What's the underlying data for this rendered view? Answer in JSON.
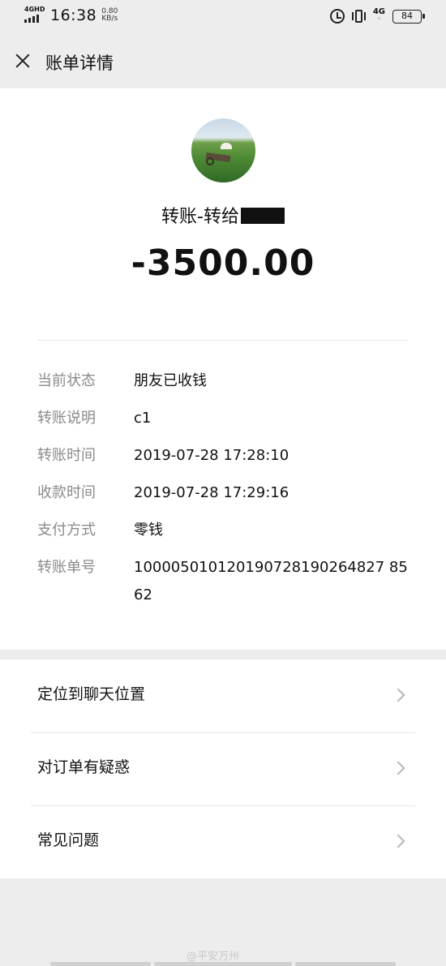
{
  "status_bar": {
    "network_label": "4GHD",
    "time": "16:38",
    "speed_value": "0.80",
    "speed_unit": "KB/s",
    "net_type": "4G",
    "battery": "84",
    "icons": [
      "signal-icon",
      "alarm-icon",
      "vibrate-icon",
      "battery-icon"
    ]
  },
  "header": {
    "title": "账单详情",
    "close_icon": "close-icon"
  },
  "transfer": {
    "payee_text": "转账-转给",
    "amount": "-3500.00"
  },
  "details": [
    {
      "label": "当前状态",
      "value": "朋友已收钱"
    },
    {
      "label": "转账说明",
      "value": "c1"
    },
    {
      "label": "转账时间",
      "value": "2019-07-28 17:28:10"
    },
    {
      "label": "收款时间",
      "value": "2019-07-28 17:29:16"
    },
    {
      "label": "支付方式",
      "value": "零钱"
    },
    {
      "label": "转账单号",
      "value": "100005010120190728190264827 8562"
    }
  ],
  "menu": [
    {
      "label": "定位到聊天位置",
      "icon": "chevron-right-icon"
    },
    {
      "label": "对订单有疑惑",
      "icon": "chevron-right-icon"
    },
    {
      "label": "常见问题",
      "icon": "chevron-right-icon"
    }
  ],
  "watermark": "@平安万州",
  "colors": {
    "page_bg": "#ededed",
    "card_bg": "#ffffff",
    "label_gray": "#8a8a8a",
    "text": "#111111"
  }
}
